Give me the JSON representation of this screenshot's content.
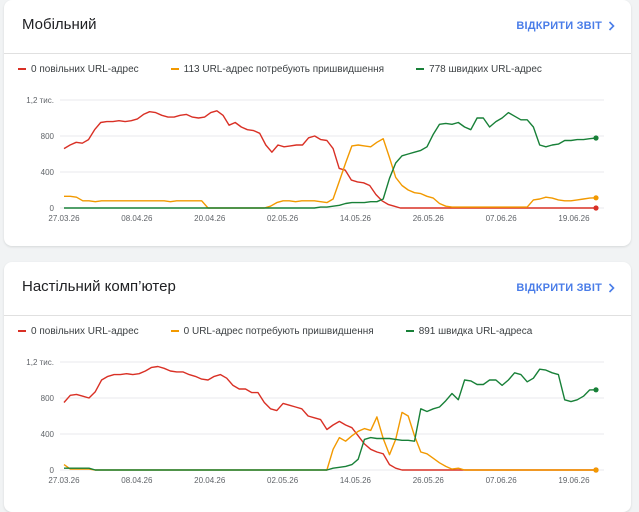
{
  "colors": {
    "slow": "#d93025",
    "needs_improvement": "#f29900",
    "fast": "#188038",
    "link": "#4a7de8",
    "grid": "#e8eaed"
  },
  "icons": {
    "open_report": "chevron-right-icon"
  },
  "cards": [
    {
      "title": "Мобільний",
      "open_report_label": "ВІДКРИТИ ЗВІТ",
      "legend": [
        "0 повільних URL-адрес",
        "113 URL-адрес потребують пришвидшення",
        "778 швидких URL-адрес"
      ],
      "chart_data": {
        "type": "line",
        "y_ticks": [
          "0",
          "400",
          "800",
          "1,2 тис."
        ],
        "y_tick_values": [
          0,
          400,
          800,
          1200
        ],
        "ylim": [
          0,
          1200
        ],
        "x_ticks": [
          "27.03.26",
          "08.04.26",
          "20.04.26",
          "02.05.26",
          "14.05.26",
          "26.05.26",
          "07.06.26",
          "19.06.26"
        ],
        "series": [
          {
            "name": "0 повільних URL-адрес",
            "values": [
              660,
              700,
              730,
              720,
              760,
              870,
              950,
              960,
              960,
              970,
              960,
              970,
              990,
              1040,
              1070,
              1060,
              1030,
              1010,
              1010,
              1030,
              1040,
              1010,
              1000,
              1010,
              1060,
              1080,
              1030,
              920,
              950,
              900,
              870,
              860,
              830,
              700,
              620,
              700,
              680,
              690,
              700,
              700,
              780,
              800,
              760,
              750,
              660,
              440,
              420,
              310,
              290,
              280,
              250,
              150,
              80,
              40,
              20,
              0,
              0,
              0,
              0,
              0,
              0,
              0,
              0,
              0,
              0,
              0,
              0,
              0,
              0,
              0,
              0,
              0,
              0,
              0,
              0,
              0,
              0,
              0,
              0,
              0,
              0,
              0,
              0,
              0,
              0,
              0,
              0,
              0
            ]
          },
          {
            "name": "113 URL-адрес потребують пришвидшення",
            "values": [
              130,
              130,
              120,
              80,
              80,
              70,
              80,
              80,
              80,
              80,
              80,
              80,
              80,
              80,
              80,
              80,
              80,
              70,
              80,
              80,
              80,
              80,
              80,
              0,
              0,
              0,
              0,
              0,
              0,
              0,
              0,
              0,
              0,
              20,
              60,
              80,
              80,
              70,
              80,
              80,
              80,
              70,
              60,
              100,
              300,
              500,
              690,
              700,
              690,
              680,
              730,
              770,
              560,
              340,
              250,
              200,
              170,
              160,
              130,
              110,
              50,
              20,
              10,
              10,
              10,
              10,
              10,
              10,
              10,
              10,
              10,
              10,
              10,
              10,
              10,
              90,
              100,
              120,
              110,
              90,
              80,
              80,
              90,
              100,
              110,
              113
            ]
          },
          {
            "name": "778 швидких URL-адрес",
            "values": [
              0,
              0,
              0,
              0,
              0,
              0,
              0,
              0,
              0,
              0,
              0,
              0,
              0,
              0,
              0,
              0,
              0,
              0,
              0,
              0,
              0,
              0,
              0,
              0,
              0,
              0,
              0,
              0,
              0,
              0,
              0,
              0,
              0,
              0,
              0,
              0,
              0,
              0,
              0,
              0,
              0,
              10,
              10,
              20,
              30,
              50,
              60,
              60,
              60,
              70,
              70,
              100,
              330,
              500,
              580,
              600,
              620,
              640,
              680,
              820,
              930,
              940,
              930,
              950,
              900,
              870,
              1000,
              1000,
              900,
              960,
              1000,
              1060,
              1020,
              980,
              980,
              900,
              700,
              680,
              700,
              710,
              750,
              750,
              760,
              760,
              770,
              778
            ]
          }
        ]
      }
    },
    {
      "title": "Настільний комп’ютер",
      "open_report_label": "ВІДКРИТИ ЗВІТ",
      "legend": [
        "0 повільних URL-адрес",
        "0 URL-адрес потребують пришвидшення",
        "891 швидка URL-адреса"
      ],
      "chart_data": {
        "type": "line",
        "y_ticks": [
          "0",
          "400",
          "800",
          "1,2 тис."
        ],
        "y_tick_values": [
          0,
          400,
          800,
          1200
        ],
        "ylim": [
          0,
          1200
        ],
        "x_ticks": [
          "27.03.26",
          "08.04.26",
          "20.04.26",
          "02.05.26",
          "14.05.26",
          "26.05.26",
          "07.06.26",
          "19.06.26"
        ],
        "series": [
          {
            "name": "0 повільних URL-адрес",
            "values": [
              750,
              830,
              840,
              820,
              800,
              870,
              1000,
              1040,
              1060,
              1060,
              1070,
              1060,
              1070,
              1100,
              1140,
              1150,
              1130,
              1100,
              1090,
              1090,
              1060,
              1040,
              1010,
              1000,
              1040,
              1060,
              1020,
              940,
              900,
              900,
              860,
              860,
              750,
              680,
              660,
              740,
              720,
              700,
              680,
              600,
              580,
              560,
              450,
              500,
              540,
              500,
              470,
              380,
              290,
              230,
              200,
              180,
              60,
              20,
              0,
              0,
              0,
              0,
              0,
              0,
              0,
              0,
              0,
              0,
              0,
              0,
              0,
              0,
              0,
              0,
              0,
              0,
              0,
              0,
              0,
              0,
              0,
              0,
              0,
              0,
              0,
              0,
              0,
              0,
              0,
              0
            ]
          },
          {
            "name": "0 URL-адрес потребують пришвидшення",
            "values": [
              60,
              10,
              10,
              10,
              10,
              0,
              0,
              0,
              0,
              0,
              0,
              0,
              0,
              0,
              0,
              0,
              0,
              0,
              0,
              0,
              0,
              0,
              0,
              0,
              0,
              0,
              0,
              0,
              0,
              0,
              0,
              0,
              0,
              0,
              0,
              0,
              0,
              0,
              0,
              0,
              0,
              0,
              0,
              230,
              360,
              320,
              380,
              430,
              460,
              440,
              590,
              350,
              170,
              340,
              640,
              600,
              380,
              200,
              180,
              130,
              80,
              40,
              10,
              20,
              0,
              0,
              0,
              0,
              0,
              0,
              0,
              0,
              0,
              0,
              0,
              0,
              0,
              0,
              0,
              0,
              0,
              0,
              0,
              0,
              0,
              0
            ]
          },
          {
            "name": "891 швидка URL-адреса",
            "values": [
              20,
              20,
              20,
              20,
              20,
              0,
              0,
              0,
              0,
              0,
              0,
              0,
              0,
              0,
              0,
              0,
              0,
              0,
              0,
              0,
              0,
              0,
              0,
              0,
              0,
              0,
              0,
              0,
              0,
              0,
              0,
              0,
              0,
              0,
              0,
              0,
              0,
              0,
              0,
              0,
              0,
              0,
              0,
              20,
              30,
              40,
              60,
              120,
              340,
              360,
              350,
              350,
              350,
              340,
              330,
              330,
              320,
              680,
              650,
              680,
              700,
              770,
              850,
              780,
              1000,
              990,
              950,
              950,
              1000,
              1000,
              940,
              1000,
              1080,
              1060,
              980,
              1020,
              1120,
              1110,
              1080,
              1060,
              780,
              760,
              780,
              820,
              890,
              891
            ]
          }
        ]
      }
    }
  ]
}
